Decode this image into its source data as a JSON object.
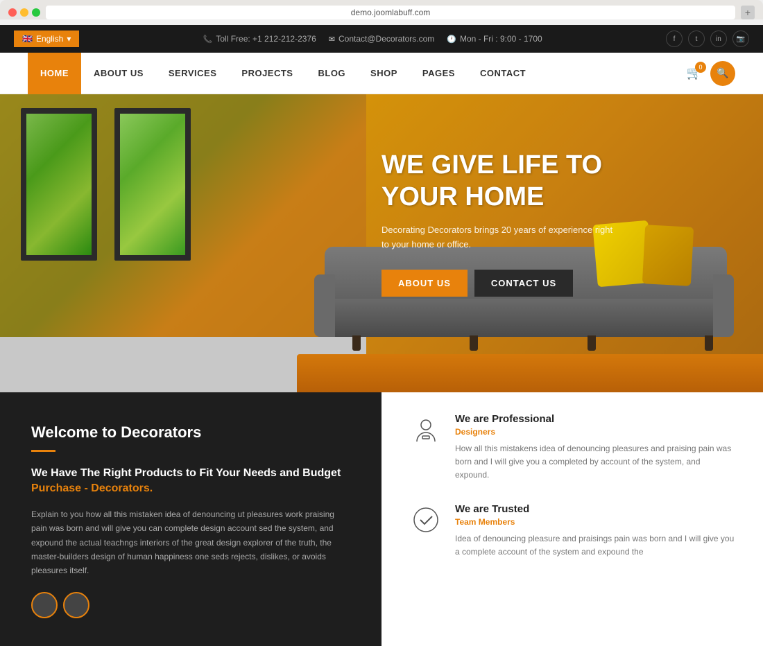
{
  "browser": {
    "url": "demo.joomlabuff.com",
    "dots": [
      "red",
      "yellow",
      "green"
    ]
  },
  "topbar": {
    "language": "English",
    "phone_icon": "📞",
    "phone": "Toll Free: +1 212-212-2376",
    "email_icon": "✉",
    "email": "Contact@Decorators.com",
    "hours_icon": "🕐",
    "hours": "Mon - Fri : 9:00 - 1700",
    "social": [
      "f",
      "t",
      "in",
      "📷"
    ]
  },
  "nav": {
    "items": [
      {
        "label": "HOME",
        "active": true
      },
      {
        "label": "ABOUT US",
        "active": false
      },
      {
        "label": "SERVICES",
        "active": false
      },
      {
        "label": "PROJECTS",
        "active": false
      },
      {
        "label": "BLOG",
        "active": false
      },
      {
        "label": "SHOP",
        "active": false
      },
      {
        "label": "PAGES",
        "active": false
      },
      {
        "label": "CONTACT",
        "active": false
      }
    ],
    "cart_count": "0"
  },
  "hero": {
    "title_line1": "WE GIVE LIFE TO",
    "title_line2": "YOUR HOME",
    "subtitle": "Decorating Decorators brings 20 years of experience right to your home or office.",
    "btn_about": "ABOUT US",
    "btn_contact": "CONTACT US"
  },
  "welcome": {
    "title": "Welcome to Decorators",
    "subtitle": "We Have The Right Products to Fit Your Needs and Budget",
    "link_text": "Purchase - Decorators.",
    "body": "Explain to you how all this mistaken idea of denouncing ut pleasures work praising pain was born and will give you can complete design account sed the system, and expound the actual teachngs interiors of the great design explorer of the truth, the master-builders design of human happiness one seds rejects, dislikes, or avoids pleasures itself.",
    "features": [
      {
        "icon_type": "person",
        "title": "We are Professional",
        "subtitle": "Designers",
        "desc": "How all this mistakens idea of denouncing pleasures and praising pain was born and I will give you a completed by account of the system, and expound."
      },
      {
        "icon_type": "check",
        "title": "We are Trusted",
        "subtitle": "Team Members",
        "desc": "Idea of denouncing pleasure and praisings pain was born and I will give you a complete account of the system and expound the"
      }
    ]
  }
}
